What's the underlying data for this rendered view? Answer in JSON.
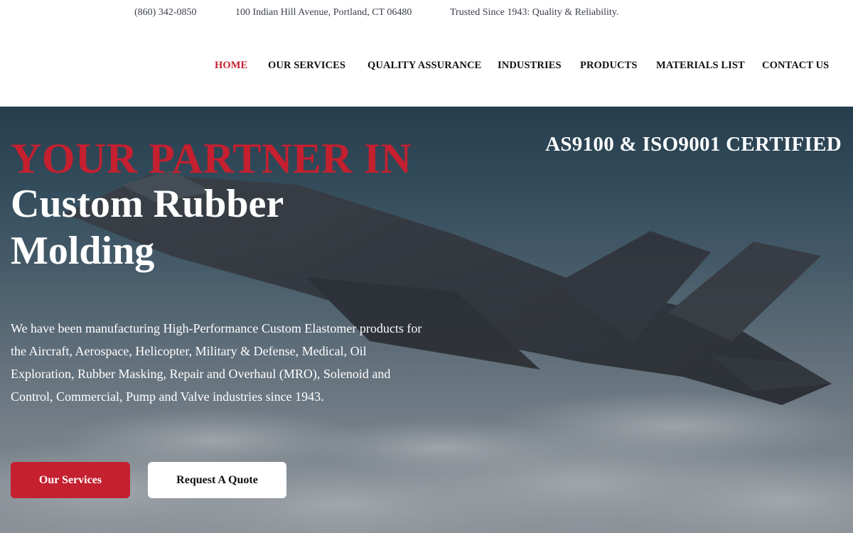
{
  "topbar": {
    "phone": "(860) 342-0850",
    "address": "100 Indian Hill Avenue, Portland, CT 06480",
    "tagline": "Trusted Since 1943: Quality & Reliability."
  },
  "nav": {
    "items": [
      {
        "label": "HOME",
        "active": true
      },
      {
        "label": "OUR SERVICES"
      },
      {
        "label": "QUALITY ASSURANCE"
      },
      {
        "label": "INDUSTRIES"
      },
      {
        "label": "PRODUCTS"
      },
      {
        "label": "MATERIALS LIST"
      },
      {
        "label": "CONTACT US"
      }
    ]
  },
  "hero": {
    "eyebrow": "YOUR PARTNER IN",
    "headline": "Custom Rubber Molding",
    "certification": "AS9100 & ISO9001 CERTIFIED",
    "description": "We have been manufacturing High-Performance Custom Elastomer products for the Aircraft, Aerospace, Helicopter, Military & Defense, Medical, Oil Exploration, Rubber Masking, Repair and Overhaul (MRO), Solenoid and Control, Commercial, Pump and Valve industries since 1943.",
    "primary_button": "Our Services",
    "secondary_button": "Request A Quote",
    "background_image": "fighter-jet-over-clouds"
  },
  "colors": {
    "accent_red": "#c4202f",
    "white": "#ffffff",
    "nav_text": "#111111"
  }
}
